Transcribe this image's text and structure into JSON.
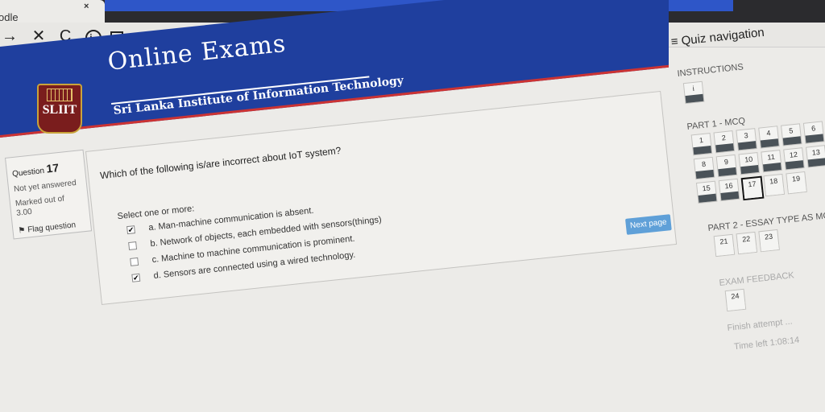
{
  "browser": {
    "tab_title": "odle",
    "tab_close": "×",
    "nav_icons": [
      "arrow-forward-icon",
      "stop-icon",
      "reload-icon",
      "site-info-icon",
      "page-icon"
    ]
  },
  "header": {
    "title": "Online Exams",
    "subtitle": "Sri Lanka Institute of Information Technology",
    "logo_text": "SLIIT"
  },
  "question_info": {
    "label": "Question",
    "number": "17",
    "status": "Not yet answered",
    "marked_out_of": "Marked out of",
    "marks": "3.00",
    "flag_label": "Flag question"
  },
  "question": {
    "text": "Which of the following is/are incorrect about IoT system?",
    "select_label": "Select one or more:",
    "options": [
      {
        "label": "a. Man-machine communication is absent.",
        "checked": true
      },
      {
        "label": "b. Network of objects, each embedded with sensors(things)",
        "checked": false
      },
      {
        "label": "c. Machine to machine communication is prominent.",
        "checked": false
      },
      {
        "label": "d. Sensors are connected using a wired technology.",
        "checked": true
      }
    ]
  },
  "next_button": "Next page",
  "quiz_nav": {
    "title": "≡ Quiz navigation",
    "sections": [
      {
        "label": "INSTRUCTIONS",
        "items": [
          "i"
        ]
      },
      {
        "label": "PART 1 - MCQ",
        "items": [
          "1",
          "2",
          "3",
          "4",
          "5",
          "6",
          "8",
          "9",
          "10",
          "11",
          "12",
          "13",
          "15",
          "16",
          "17",
          "18",
          "19"
        ]
      },
      {
        "label": "PART 2 - ESSAY TYPE AS MC",
        "items": [
          "21",
          "22",
          "23"
        ]
      },
      {
        "label": "EXAM FEEDBACK",
        "items": [
          "24"
        ]
      }
    ],
    "current": "17",
    "finish": "Finish attempt ...",
    "time_left": "Time left 1:08:14"
  },
  "colors": {
    "banner": "#1f3f9e",
    "accent_red": "#cc3333",
    "button": "#5fa0d8"
  }
}
